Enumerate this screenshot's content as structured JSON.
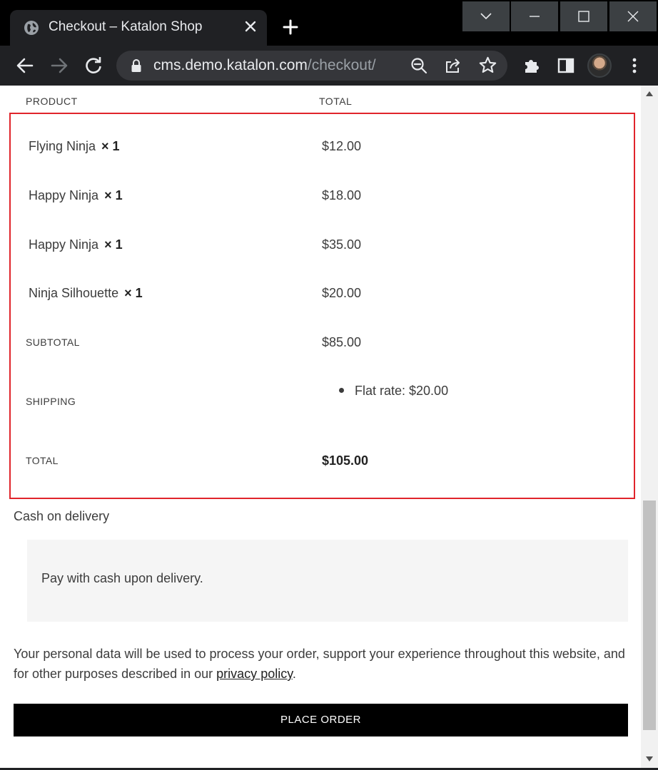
{
  "browser": {
    "tab_title": "Checkout – Katalon Shop",
    "url_host": "cms.demo.katalon.com",
    "url_path": "/checkout/"
  },
  "order_table": {
    "headers": {
      "product": "PRODUCT",
      "total": "TOTAL"
    },
    "items": [
      {
        "name": "Flying Ninja",
        "qty": "× 1",
        "price": "$12.00"
      },
      {
        "name": "Happy Ninja",
        "qty": "× 1",
        "price": "$18.00"
      },
      {
        "name": "Happy Ninja",
        "qty": "× 1",
        "price": "$35.00"
      },
      {
        "name": "Ninja Silhouette",
        "qty": "× 1",
        "price": "$20.00"
      }
    ],
    "subtotal_label": "SUBTOTAL",
    "subtotal_value": "$85.00",
    "shipping_label": "SHIPPING",
    "shipping_option": "Flat rate: $20.00",
    "total_label": "TOTAL",
    "total_value": "$105.00"
  },
  "payment": {
    "method": "Cash on delivery",
    "description": "Pay with cash upon delivery."
  },
  "privacy": {
    "text_before": "Your personal data will be used to process your order, support your experience throughout this website, and for other purposes described in our ",
    "link": "privacy policy",
    "text_after": "."
  },
  "actions": {
    "place_order": "PLACE ORDER"
  },
  "colors": {
    "highlight_border": "#e0242b",
    "button_bg": "#000000",
    "payment_box_bg": "#f5f5f5"
  }
}
